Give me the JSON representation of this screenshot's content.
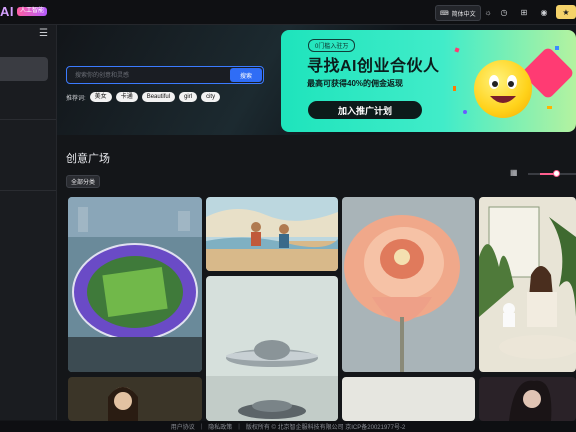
{
  "header": {
    "logo_text": "AI",
    "logo_badge": "人工智能",
    "language_label": "简体中文",
    "icons": [
      "language-icon",
      "theme-icon",
      "history-icon",
      "gift-icon",
      "bell-icon"
    ]
  },
  "search": {
    "placeholder": "搜索你的创意和灵感",
    "button_label": "搜索"
  },
  "recommend": {
    "label": "推荐词:",
    "tags": [
      "美女",
      "卡通",
      "Beautiful",
      "girl",
      "city"
    ]
  },
  "banner": {
    "chip": "0门槛入驻万",
    "title": "寻找AI创业合伙人",
    "subtitle": "最高可获得40%的佣金返现",
    "cta": "加入推广计划"
  },
  "gallery": {
    "title": "创意广场",
    "category_label": "全部分类",
    "zoom_level": 0.6
  },
  "footer": {
    "items": [
      "用户协议",
      "隐私政策",
      "版权所有 © 北京智企服科技有限公司 京ICP备20021977号-2"
    ]
  },
  "colors": {
    "accent": "#2f6df6",
    "banner_start": "#1ee4bc",
    "banner_end": "#b4f2a0",
    "slider": "#ff5f8f"
  }
}
